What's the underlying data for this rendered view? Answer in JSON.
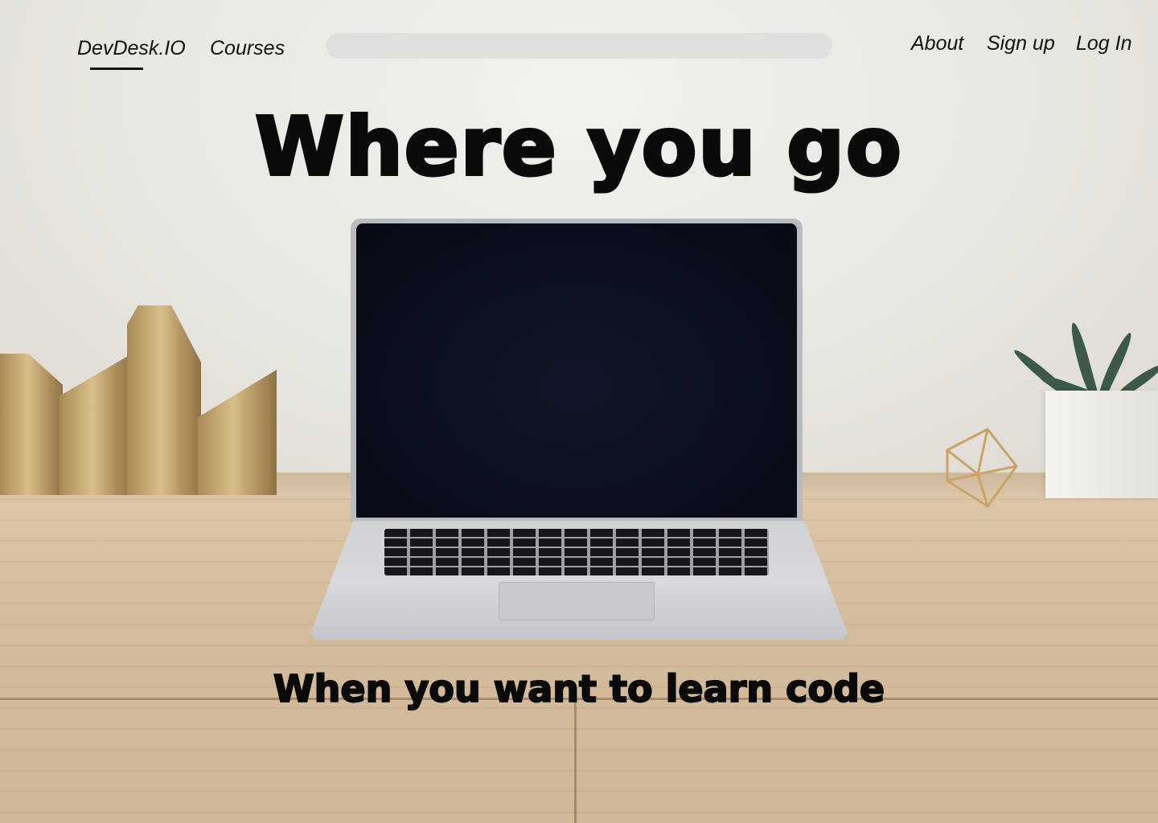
{
  "nav": {
    "brand": "DevDesk.IO",
    "courses_label": "Courses",
    "search": {
      "value": "",
      "placeholder": ""
    },
    "about_label": "About",
    "signup_label": "Sign up",
    "login_label": "Log In"
  },
  "hero": {
    "title": "Where you go",
    "subtitle": "When you want to learn code"
  },
  "colors": {
    "text": "#0a0a0a",
    "search_bg": "#dedede",
    "desk": "#d3bc9c",
    "wall": "#ecebe6"
  }
}
